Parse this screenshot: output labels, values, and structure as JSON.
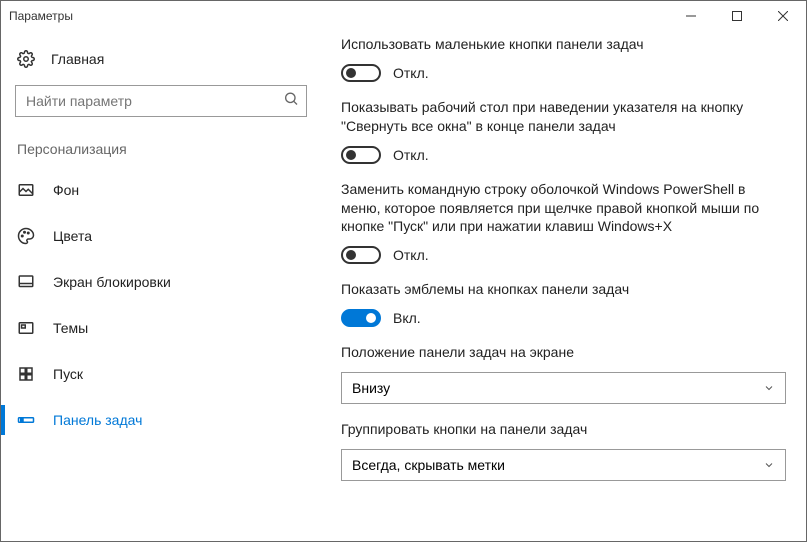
{
  "window": {
    "title": "Параметры"
  },
  "sidebar": {
    "home": "Главная",
    "search_placeholder": "Найти параметр",
    "section": "Персонализация",
    "items": [
      {
        "label": "Фон"
      },
      {
        "label": "Цвета"
      },
      {
        "label": "Экран блокировки"
      },
      {
        "label": "Темы"
      },
      {
        "label": "Пуск"
      },
      {
        "label": "Панель задач"
      }
    ]
  },
  "settings": {
    "small_buttons": {
      "label": "Использовать маленькие кнопки панели задач",
      "state": "Откл."
    },
    "show_desktop": {
      "label": "Показывать рабочий стол при наведении указателя на кнопку \"Свернуть все окна\" в конце панели задач",
      "state": "Откл."
    },
    "powershell": {
      "label": "Заменить командную строку оболочкой Windows PowerShell в меню, которое появляется при щелчке правой кнопкой мыши по кнопке \"Пуск\" или при нажатии клавиш Windows+X",
      "state": "Откл."
    },
    "badges": {
      "label": "Показать эмблемы на кнопках панели задач",
      "state": "Вкл."
    },
    "position": {
      "label": "Положение панели задач на экране",
      "value": "Внизу"
    },
    "grouping": {
      "label": "Группировать кнопки на панели задач",
      "value": "Всегда, скрывать метки"
    }
  }
}
